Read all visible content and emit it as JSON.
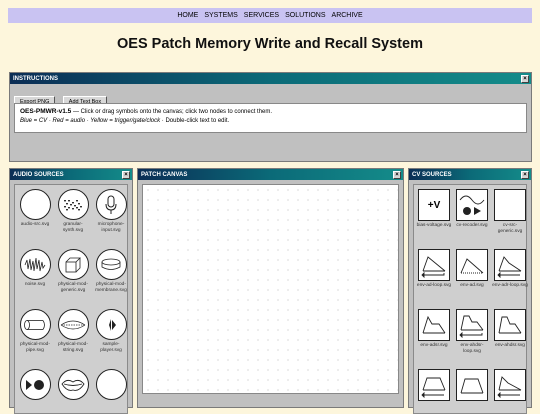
{
  "nav": {
    "items": [
      "HOME",
      "SYSTEMS",
      "SERVICES",
      "SOLUTIONS",
      "ARCHIVE"
    ]
  },
  "page_title": "OES Patch Memory Write and Recall System",
  "instructions": {
    "title": "INSTRUCTIONS",
    "close": "×",
    "export_label": "Export PNG",
    "add_text_label": "Add Text Box",
    "version": "OES-PMWR-v1.5",
    "line1": " — Click or drag symbols onto the canvas; click two nodes to connect them.",
    "legend": "Blue = CV · Red = audio · Yellow = trigger/gate/clock",
    "legend_tail": " · Double-click text to edit."
  },
  "audio_sources": {
    "title": "AUDIO SOURCES",
    "close": "×",
    "items": [
      {
        "label": "audio-src.svg",
        "icon": "blank-circle-icon"
      },
      {
        "label": "granular-synth.svg",
        "icon": "granular-icon"
      },
      {
        "label": "microphone-input.svg",
        "icon": "microphone-icon"
      },
      {
        "label": "noise.svg",
        "icon": "noise-icon"
      },
      {
        "label": "physical-mod-generic.svg",
        "icon": "cube-icon"
      },
      {
        "label": "physical-mod-membrane.svg",
        "icon": "drum-icon"
      },
      {
        "label": "physical-mod-pipe.svg",
        "icon": "pipe-icon"
      },
      {
        "label": "physical-mod-string.svg",
        "icon": "string-icon"
      },
      {
        "label": "sample-player.svg",
        "icon": "sample-player-icon"
      },
      {
        "label": "",
        "icon": "trigger-dot-icon"
      },
      {
        "label": "",
        "icon": "lips-icon"
      },
      {
        "label": "",
        "icon": "blank-circle-icon"
      }
    ]
  },
  "patch_canvas": {
    "title": "PATCH CANVAS",
    "close": "×"
  },
  "cv_sources": {
    "title": "CV SOURCES",
    "close": "×",
    "items": [
      {
        "label": "bias-voltage.svg",
        "icon": "bias-voltage-icon",
        "text": "+V"
      },
      {
        "label": "cv-recoder.svg",
        "icon": "cv-recorder-icon"
      },
      {
        "label": "cv-src-generic.svg",
        "icon": "blank-square-icon"
      },
      {
        "label": "env-ad-loop.svg",
        "icon": "env-ad-loop-icon"
      },
      {
        "label": "env-ad.svg",
        "icon": "env-ad-icon"
      },
      {
        "label": "env-adr-loop.svg",
        "icon": "env-adr-loop-icon"
      },
      {
        "label": "env-adsr.svg",
        "icon": "env-adsr-icon"
      },
      {
        "label": "env-ahdsr-loop.svg",
        "icon": "env-ahdsr-loop-icon"
      },
      {
        "label": "env-ahdsr.svg",
        "icon": "env-ahdsr-icon"
      },
      {
        "label": "",
        "icon": "env-loop-icon"
      },
      {
        "label": "",
        "icon": "env-icon"
      },
      {
        "label": "",
        "icon": "env-loop-icon"
      }
    ]
  }
}
